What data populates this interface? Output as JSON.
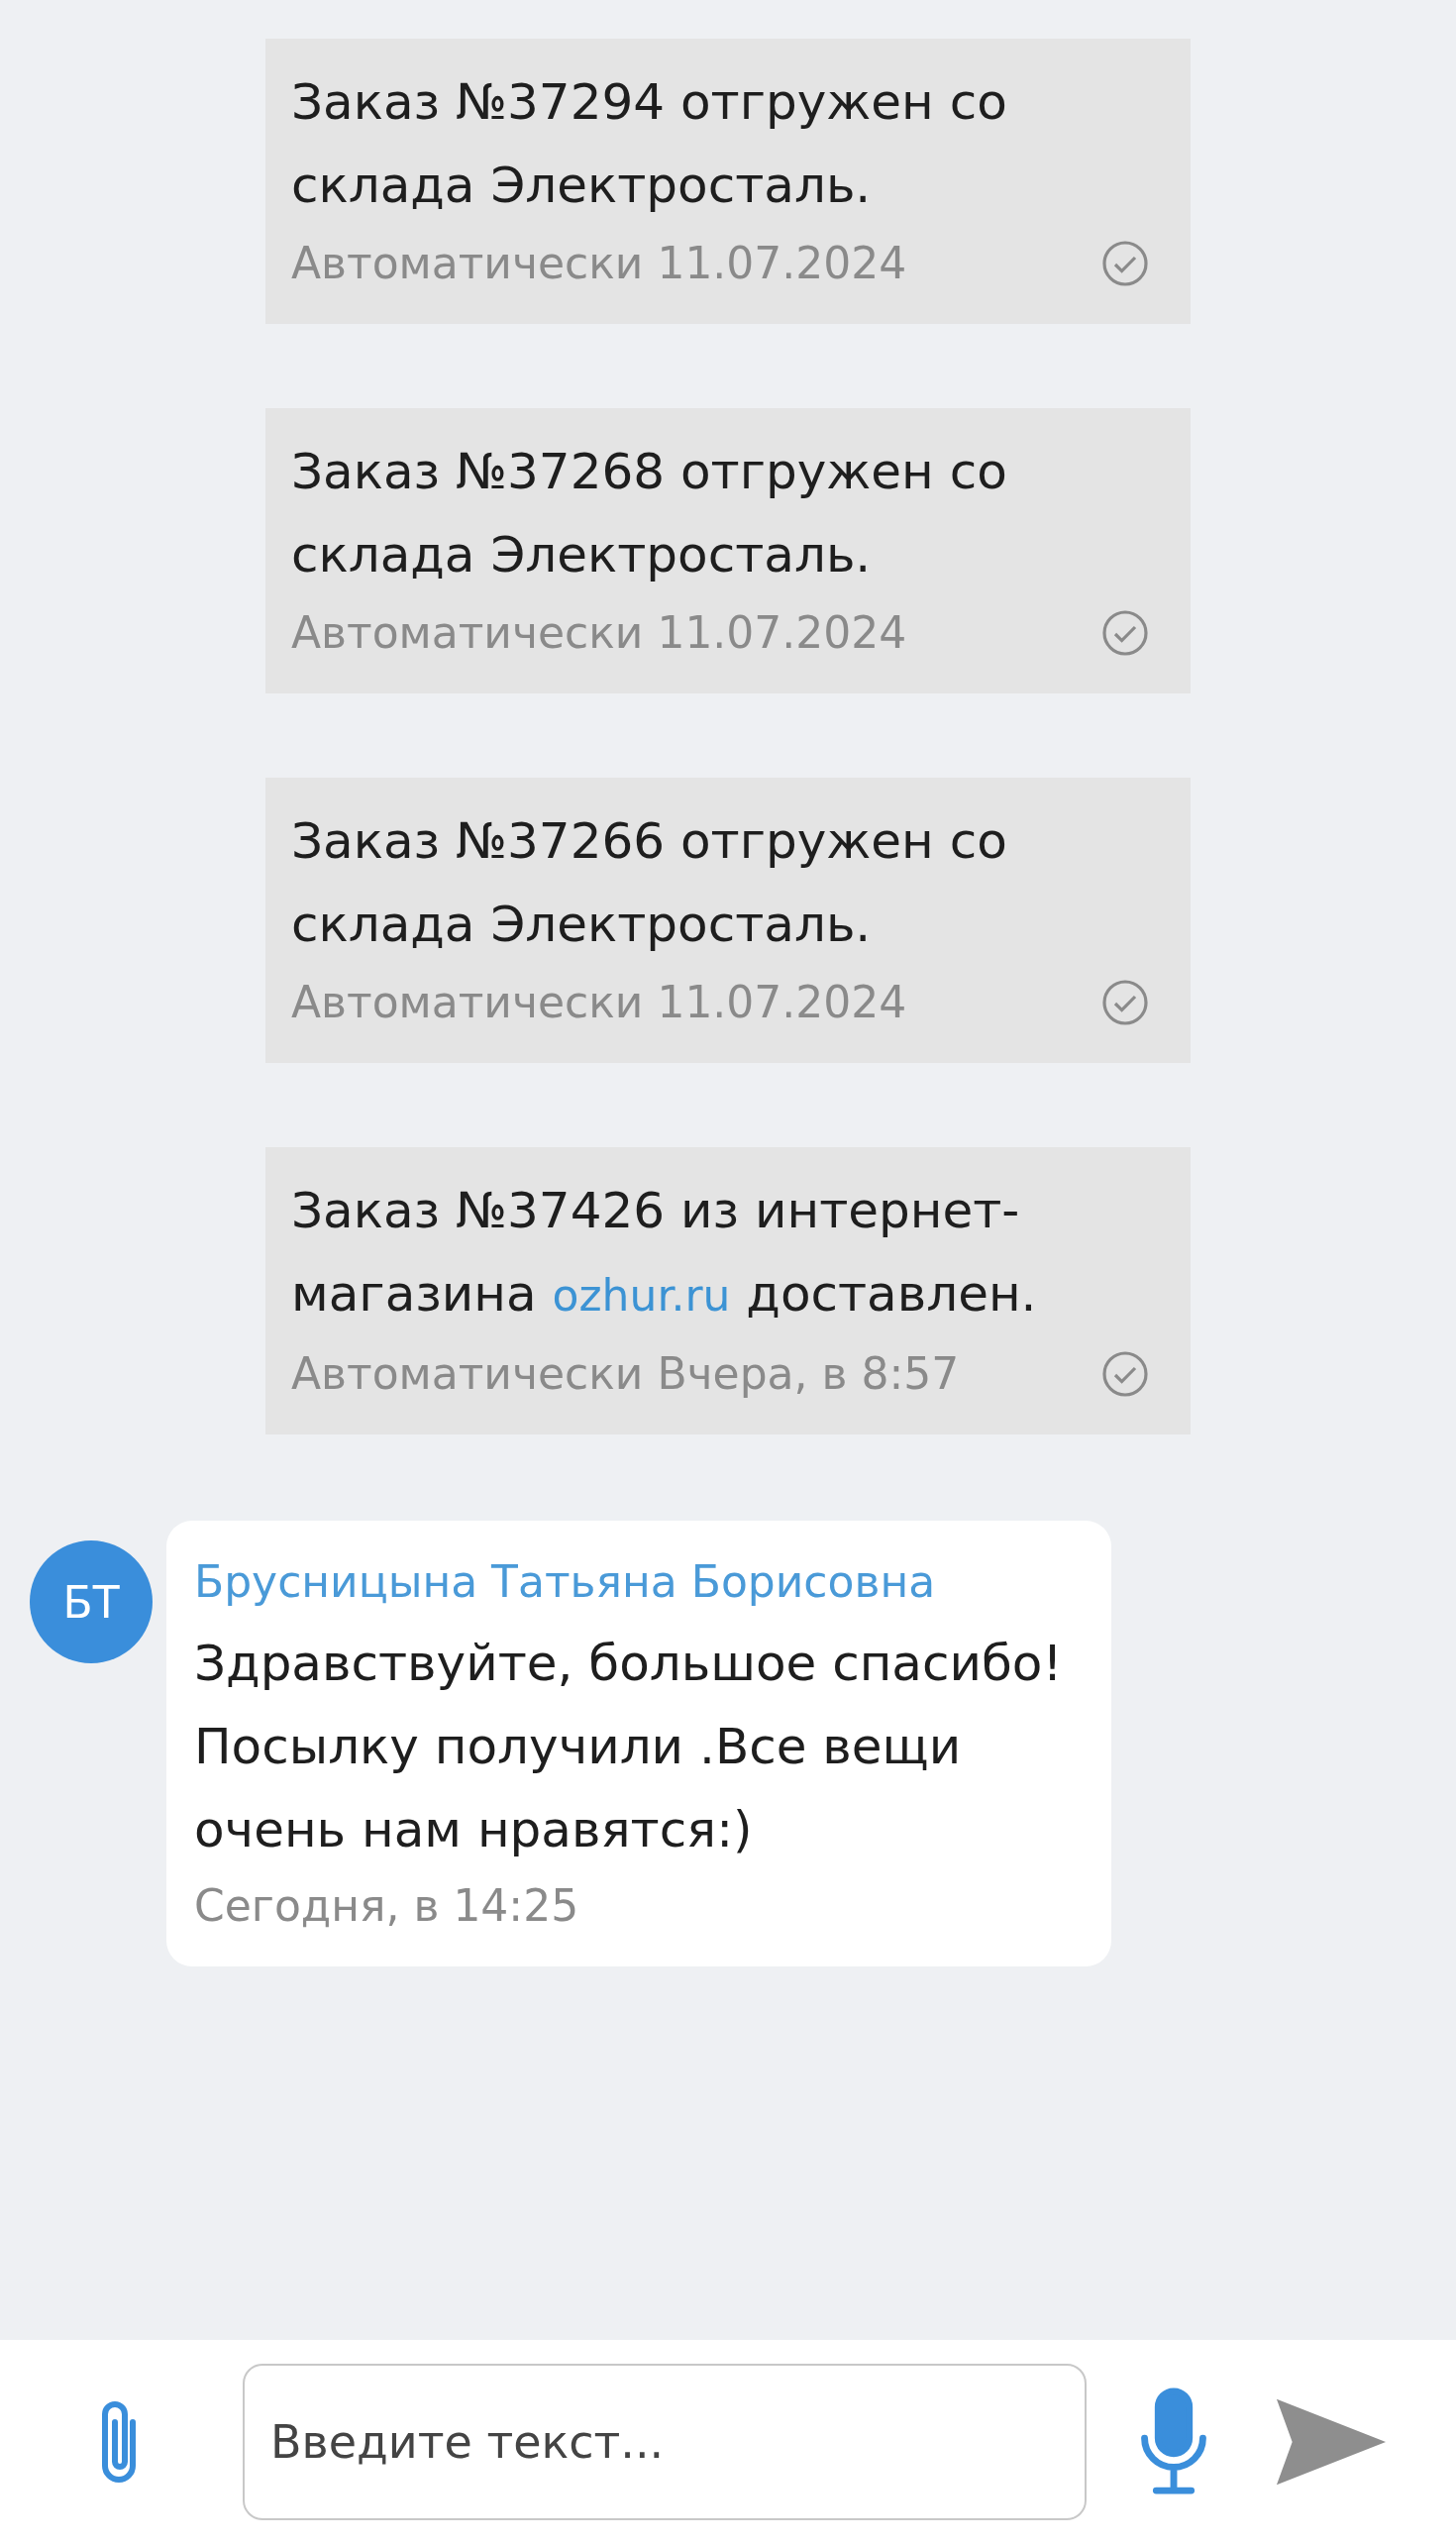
{
  "messages": [
    {
      "kind": "system",
      "text": "Заказ №37294 отгружен со склада Электросталь.",
      "meta": "Автоматически 11.07.2024"
    },
    {
      "kind": "system",
      "text": "Заказ №37268 отгружен со склада Электросталь.",
      "meta": "Автоматически 11.07.2024"
    },
    {
      "kind": "system",
      "text": "Заказ №37266 отгружен со склада Электросталь.",
      "meta": "Автоматически 11.07.2024"
    },
    {
      "kind": "system",
      "text": "Заказ №37426 из интернет-магазина",
      "link": "ozhur.ru",
      "text_after": "доставлен.",
      "meta": "Автоматически Вчера, в 8:57"
    },
    {
      "kind": "incoming",
      "avatar": "БТ",
      "sender": "Брусницына Татьяна Борисовна",
      "text": "Здравствуйте, большое спасибо! Посылку получили .Все вещи очень нам нравятся:)",
      "meta": "Сегодня, в 14:25"
    }
  ],
  "composer": {
    "placeholder": "Введите текст..."
  }
}
